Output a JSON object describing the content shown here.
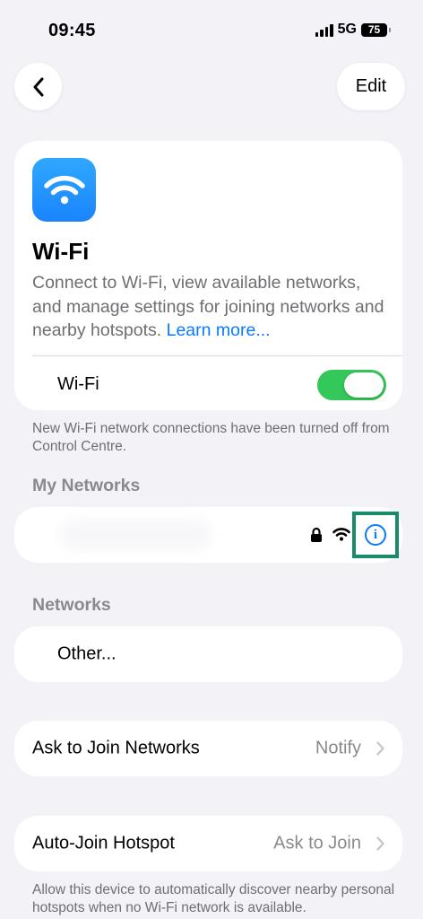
{
  "status": {
    "time": "09:45",
    "network": "5G",
    "battery": "75"
  },
  "nav": {
    "back_icon": "chevron-left-icon",
    "edit_label": "Edit"
  },
  "hero": {
    "icon": "wifi-icon",
    "title": "Wi-Fi",
    "description": "Connect to Wi-Fi, view available networks, and manage settings for joining networks and nearby hotspots.",
    "learn_more": "Learn more...",
    "toggle_label": "Wi-Fi",
    "toggle_on": true
  },
  "control_centre_note": "New Wi-Fi network connections have been turned off from Control Centre.",
  "my_networks": {
    "header": "My Networks",
    "icons": [
      "lock-icon",
      "wifi-signal-icon",
      "info-icon"
    ]
  },
  "networks": {
    "header": "Networks",
    "other_label": "Other..."
  },
  "ask_to_join": {
    "label": "Ask to Join Networks",
    "value": "Notify"
  },
  "auto_join": {
    "label": "Auto-Join Hotspot",
    "value": "Ask to Join",
    "footnote": "Allow this device to automatically discover nearby personal hotspots when no Wi-Fi network is available."
  },
  "colors": {
    "background": "#f2f2f7",
    "accent": "#0a7aff",
    "toggle_on": "#34c759",
    "highlight": "#1a8a6d",
    "secondary_text": "#6e6e73"
  }
}
